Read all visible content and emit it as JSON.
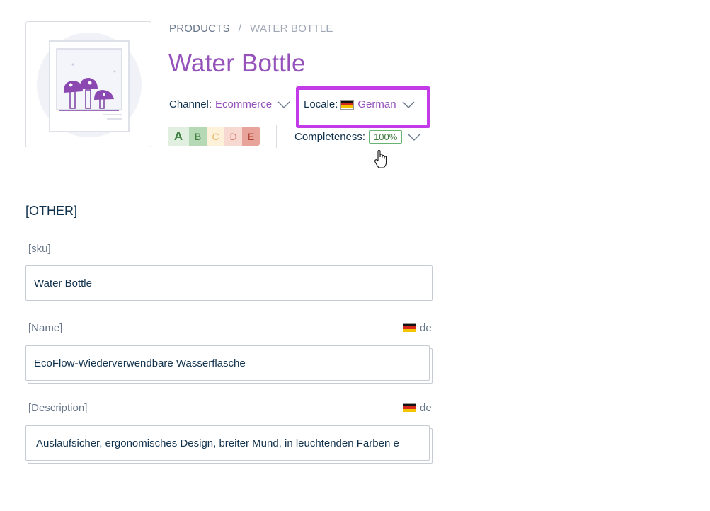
{
  "breadcrumb": {
    "root": "PRODUCTS",
    "separator": "/",
    "current": "WATER BOTTLE"
  },
  "product": {
    "title": "Water Bottle"
  },
  "context": {
    "channel_label": "Channel:",
    "channel_value": "Ecommerce",
    "locale_label": "Locale:",
    "locale_value": "German",
    "completeness_label": "Completeness:",
    "completeness_value": "100%"
  },
  "grades": [
    "A",
    "B",
    "C",
    "D",
    "E"
  ],
  "section": {
    "title": "[OTHER]"
  },
  "fields": {
    "sku": {
      "label": "[sku]",
      "value": "Water Bottle"
    },
    "name": {
      "label": "[Name]",
      "locale": "de",
      "value": "EcoFlow-Wiederverwendbare Wasserflasche"
    },
    "description": {
      "label": "[Description]",
      "locale": "de",
      "value": "Auslaufsicher, ergonomisches Design, breiter Mund, in leuchtenden Farben e"
    }
  },
  "colors": {
    "accent": "#9452ba",
    "text": "#11324d",
    "highlight": "#c33be8",
    "success": "#67b373"
  },
  "icons": [
    "product-placeholder-icon",
    "chevron-down-icon",
    "german-flag-icon",
    "hand-cursor-icon"
  ]
}
